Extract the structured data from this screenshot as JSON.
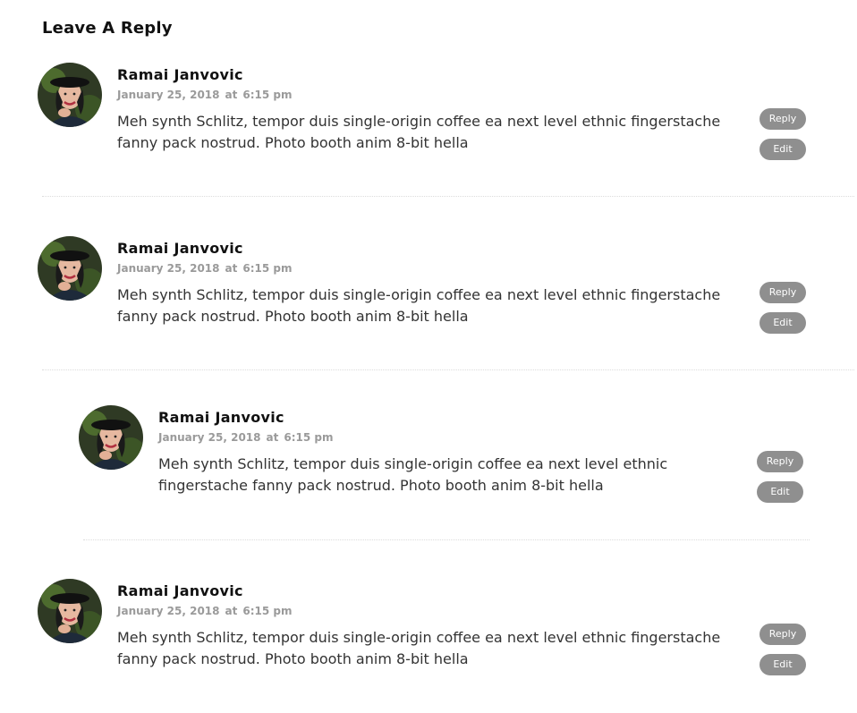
{
  "section_title": "Leave A Reply",
  "comments": [
    {
      "author": "Ramai Janvovic",
      "date": "January 25, 2018",
      "at": "at",
      "time": "6:15 pm",
      "text": "Meh synth Schlitz, tempor duis single-origin coffee ea next level ethnic fingerstache fanny pack nostrud. Photo booth anim 8-bit hella",
      "reply_label": "Reply",
      "edit_label": "Edit"
    },
    {
      "author": "Ramai Janvovic",
      "date": "January 25, 2018",
      "at": "at",
      "time": "6:15 pm",
      "text": "Meh synth Schlitz, tempor duis single-origin coffee ea next level ethnic fingerstache fanny pack nostrud. Photo booth anim 8-bit hella",
      "reply_label": "Reply",
      "edit_label": "Edit"
    },
    {
      "author": "Ramai Janvovic",
      "date": "January 25, 2018",
      "at": "at",
      "time": "6:15 pm",
      "text": "Meh synth Schlitz, tempor duis single-origin coffee ea next level ethnic fingerstache fanny pack nostrud. Photo booth anim 8-bit hella",
      "reply_label": "Reply",
      "edit_label": "Edit"
    },
    {
      "author": "Ramai Janvovic",
      "date": "January 25, 2018",
      "at": "at",
      "time": "6:15 pm",
      "text": "Meh synth Schlitz, tempor duis single-origin coffee ea next level ethnic fingerstache fanny pack nostrud. Photo booth anim 8-bit hella",
      "reply_label": "Reply",
      "edit_label": "Edit"
    }
  ],
  "colors": {
    "button_bg": "#8f8f8f",
    "meta_text": "#9a9a9a",
    "divider": "#dcdcdc"
  }
}
